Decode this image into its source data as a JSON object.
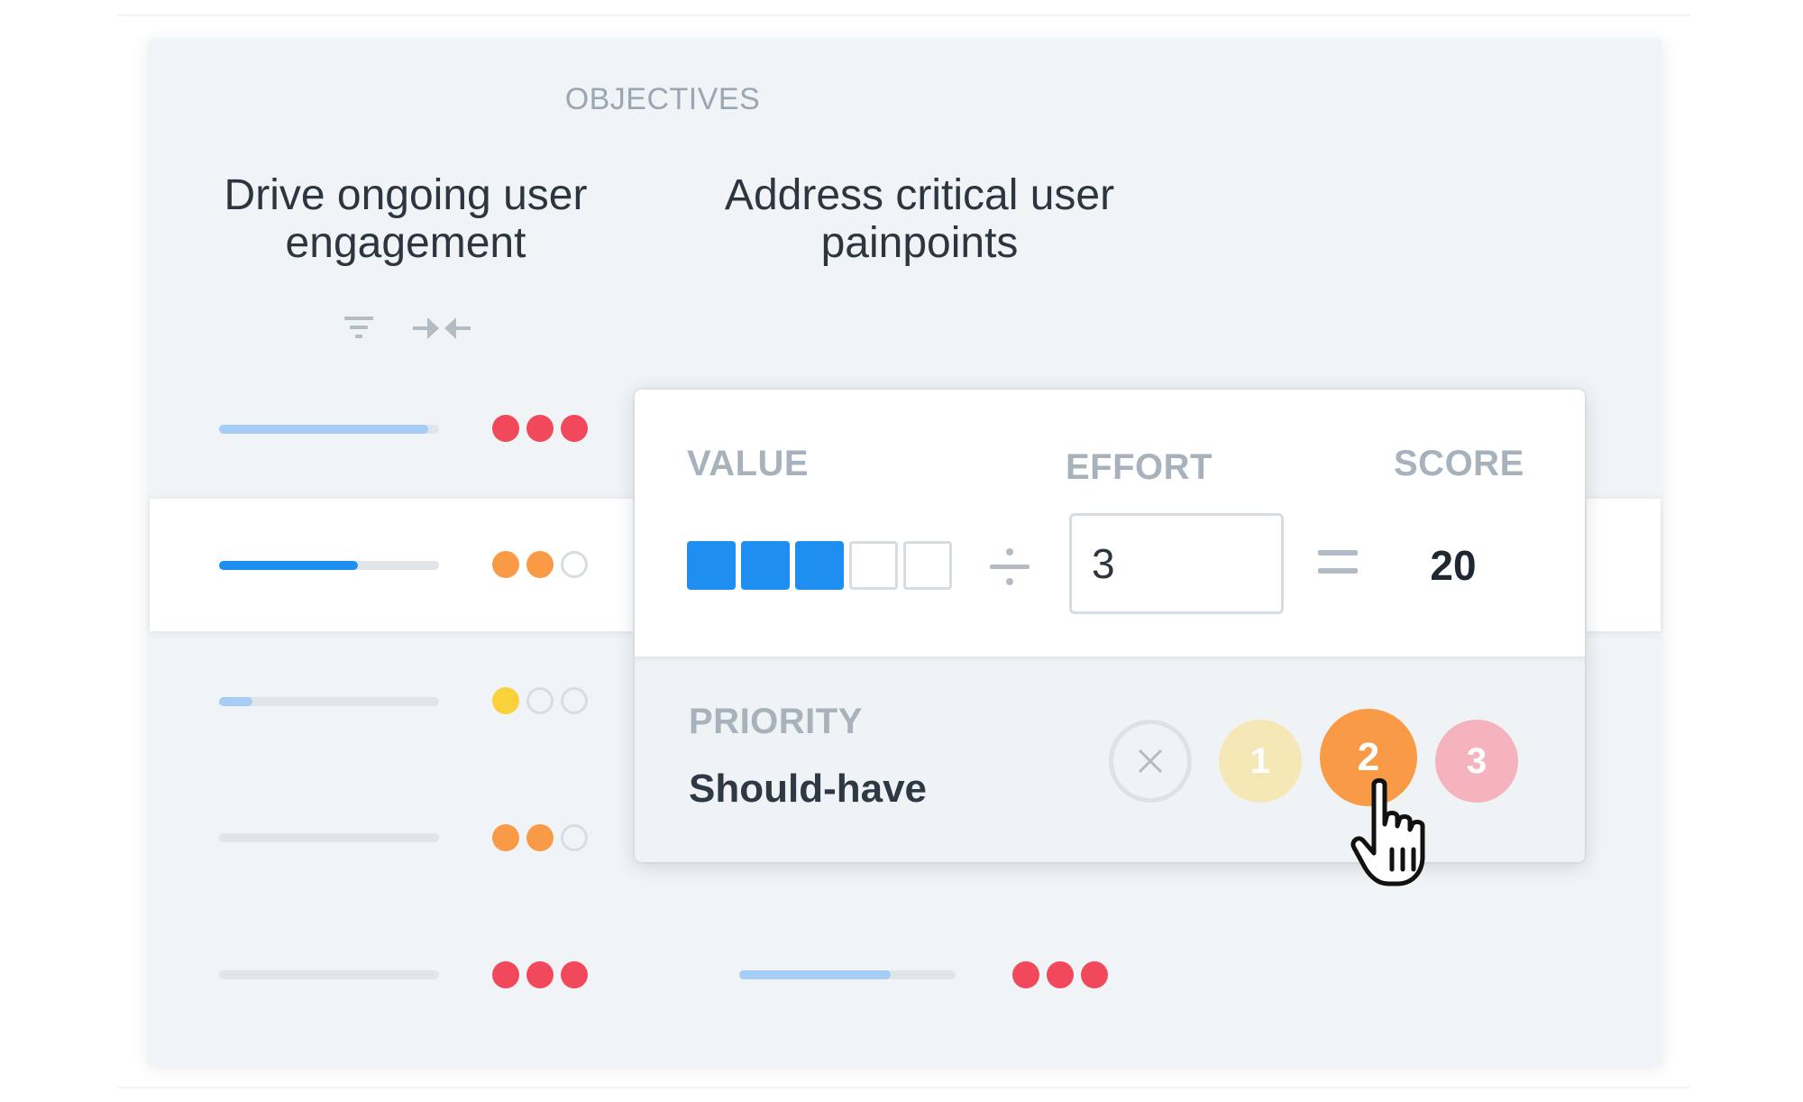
{
  "header": {
    "section_label": "OBJECTIVES"
  },
  "objectives": [
    {
      "line1": "Drive ongoing user",
      "line2": "engagement"
    },
    {
      "line1": "Address critical user",
      "line2": "painpoints"
    }
  ],
  "toolbar": {
    "filter_icon": "filter-icon",
    "collapse_icon": "collapse-columns-icon"
  },
  "rows": [
    {
      "progress": 0.95,
      "progress_color": "#a6cdf5",
      "confidence": [
        "#f2485b",
        "#f2485b",
        "#f2485b"
      ]
    },
    {
      "progress": 0.63,
      "progress_color": "#1f8ef1",
      "confidence": [
        "#f89a46",
        "#f89a46",
        "empty"
      ],
      "selected": true
    },
    {
      "progress": 0.15,
      "progress_color": "#a6cdf5",
      "confidence": [
        "#f9d13a",
        "empty",
        "empty"
      ]
    },
    {
      "progress": 0.0,
      "progress_color": "#a6cdf5",
      "confidence": [
        "#f89a46",
        "#f89a46",
        "empty"
      ]
    },
    {
      "progress": 0.0,
      "progress_color": "#a6cdf5",
      "confidence": [
        "#f2485b",
        "#f2485b",
        "#f2485b"
      ]
    }
  ],
  "row5_second_column": {
    "progress": 0.7,
    "progress_color": "#a6cdf5",
    "confidence": [
      "#f2485b",
      "#f2485b",
      "#f2485b"
    ]
  },
  "scoring_card": {
    "value_label": "VALUE",
    "value_level": 3,
    "value_max": 5,
    "divide_symbol": "÷",
    "effort_label": "EFFORT",
    "effort_value": "3",
    "equals_symbol": "=",
    "score_label": "SCORE",
    "score_value": "20",
    "priority_label": "PRIORITY",
    "priority_name": "Should-have",
    "priority_options": [
      {
        "label": "",
        "icon": "clear-x-icon"
      },
      {
        "label": "1",
        "color": "#f6e8b6"
      },
      {
        "label": "2",
        "color": "#f89a46",
        "selected": true
      },
      {
        "label": "3",
        "color": "#f5b4bd"
      }
    ]
  },
  "colors": {
    "accent_blue": "#1f8ef1",
    "red": "#f2485b",
    "orange": "#f89a46",
    "yellow": "#f9d13a"
  }
}
